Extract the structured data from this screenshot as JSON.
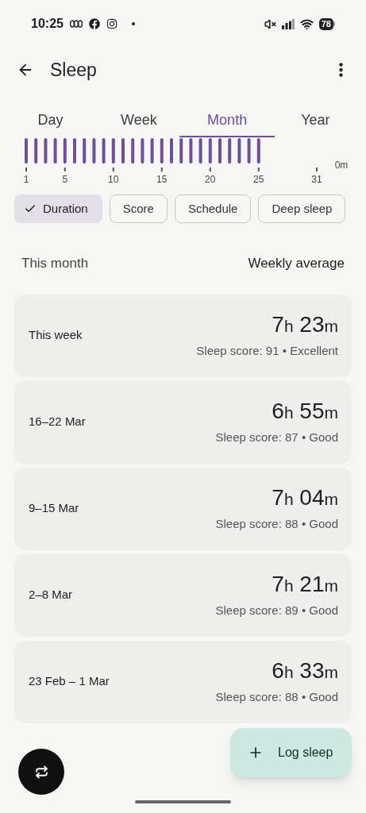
{
  "status_bar": {
    "time": "10:25",
    "battery": "78"
  },
  "header": {
    "title": "Sleep"
  },
  "tabs": [
    {
      "label": "Day",
      "selected": false
    },
    {
      "label": "Week",
      "selected": false
    },
    {
      "label": "Month",
      "selected": true
    },
    {
      "label": "Year",
      "selected": false
    }
  ],
  "chart_axis": {
    "x_labels": [
      "1",
      "5",
      "10",
      "15",
      "20",
      "25",
      "31"
    ],
    "y_label": "0m"
  },
  "filter_chips": [
    {
      "label": "Duration",
      "selected": true
    },
    {
      "label": "Score",
      "selected": false
    },
    {
      "label": "Schedule",
      "selected": false
    },
    {
      "label": "Deep sleep",
      "selected": false
    }
  ],
  "summary_header": {
    "left": "This month",
    "right": "Weekly average"
  },
  "weeks": [
    {
      "period": "This week",
      "hours": "7",
      "hours_unit": "h",
      "minutes": " 23",
      "minutes_unit": "m",
      "score": "Sleep score: 91 • Excellent"
    },
    {
      "period": "16–22 Mar",
      "hours": "6",
      "hours_unit": "h",
      "minutes": " 55",
      "minutes_unit": "m",
      "score": "Sleep score: 87 • Good"
    },
    {
      "period": "9–15 Mar",
      "hours": "7",
      "hours_unit": "h",
      "minutes": " 04",
      "minutes_unit": "m",
      "score": "Sleep score: 88 • Good"
    },
    {
      "period": "2–8 Mar",
      "hours": "7",
      "hours_unit": "h",
      "minutes": " 21",
      "minutes_unit": "m",
      "score": "Sleep score: 89 • Good"
    },
    {
      "period": "23 Feb – 1 Mar",
      "hours": "6",
      "hours_unit": "h",
      "minutes": " 33",
      "minutes_unit": "m",
      "score": "Sleep score: 88 • Good"
    }
  ],
  "fab": {
    "label": "Log sleep"
  }
}
